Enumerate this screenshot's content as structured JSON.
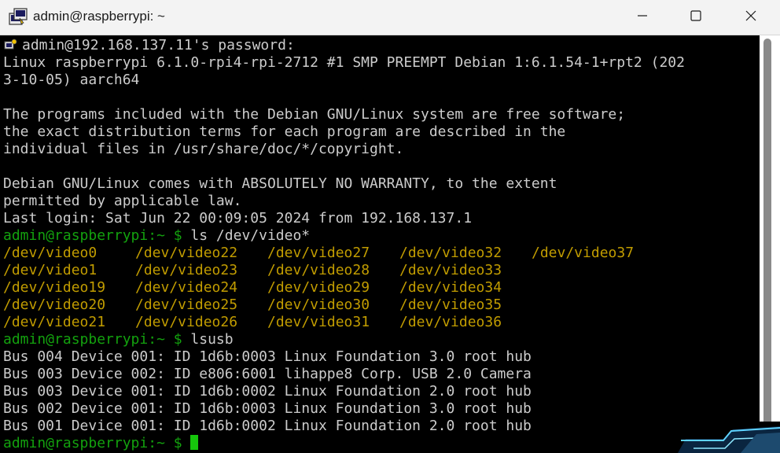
{
  "window": {
    "title": "admin@raspberrypi: ~",
    "app_icon": "putty-terminal-icon",
    "controls": {
      "minimize_icon": "minimize-icon",
      "maximize_icon": "maximize-icon",
      "close_icon": "close-icon"
    }
  },
  "colors": {
    "background": "#000000",
    "text": "#cccccc",
    "prompt": "#13a10e",
    "directory_listing": "#c19c00",
    "cursor": "#16c60c"
  },
  "terminal": {
    "password_prompt": "admin@192.168.137.11's password:",
    "uname_line1": "Linux raspberrypi 6.1.0-rpi4-rpi-2712 #1 SMP PREEMPT Debian 1:6.1.54-1+rpt2 (202",
    "uname_line2": "3-10-05) aarch64",
    "motd_line1": "The programs included with the Debian GNU/Linux system are free software;",
    "motd_line2": "the exact distribution terms for each program are described in the",
    "motd_line3": "individual files in /usr/share/doc/*/copyright.",
    "warranty_line1": "Debian GNU/Linux comes with ABSOLUTELY NO WARRANTY, to the extent",
    "warranty_line2": "permitted by applicable law.",
    "last_login": "Last login: Sat Jun 22 00:09:05 2024 from 192.168.137.1",
    "prompt": "admin@raspberrypi:~ $ ",
    "command1": "ls /dev/video*",
    "video_devices": [
      [
        "/dev/video0",
        "/dev/video22",
        "/dev/video27",
        "/dev/video32",
        "/dev/video37"
      ],
      [
        "/dev/video1",
        "/dev/video23",
        "/dev/video28",
        "/dev/video33"
      ],
      [
        "/dev/video19",
        "/dev/video24",
        "/dev/video29",
        "/dev/video34"
      ],
      [
        "/dev/video20",
        "/dev/video25",
        "/dev/video30",
        "/dev/video35"
      ],
      [
        "/dev/video21",
        "/dev/video26",
        "/dev/video31",
        "/dev/video36"
      ]
    ],
    "command2": "lsusb",
    "lsusb_output": [
      "Bus 004 Device 001: ID 1d6b:0003 Linux Foundation 3.0 root hub",
      "Bus 003 Device 002: ID e806:6001 lihappe8 Corp. USB 2.0 Camera",
      "Bus 003 Device 001: ID 1d6b:0002 Linux Foundation 2.0 root hub",
      "Bus 002 Device 001: ID 1d6b:0003 Linux Foundation 3.0 root hub",
      "Bus 001 Device 001: ID 1d6b:0002 Linux Foundation 2.0 root hub"
    ]
  }
}
